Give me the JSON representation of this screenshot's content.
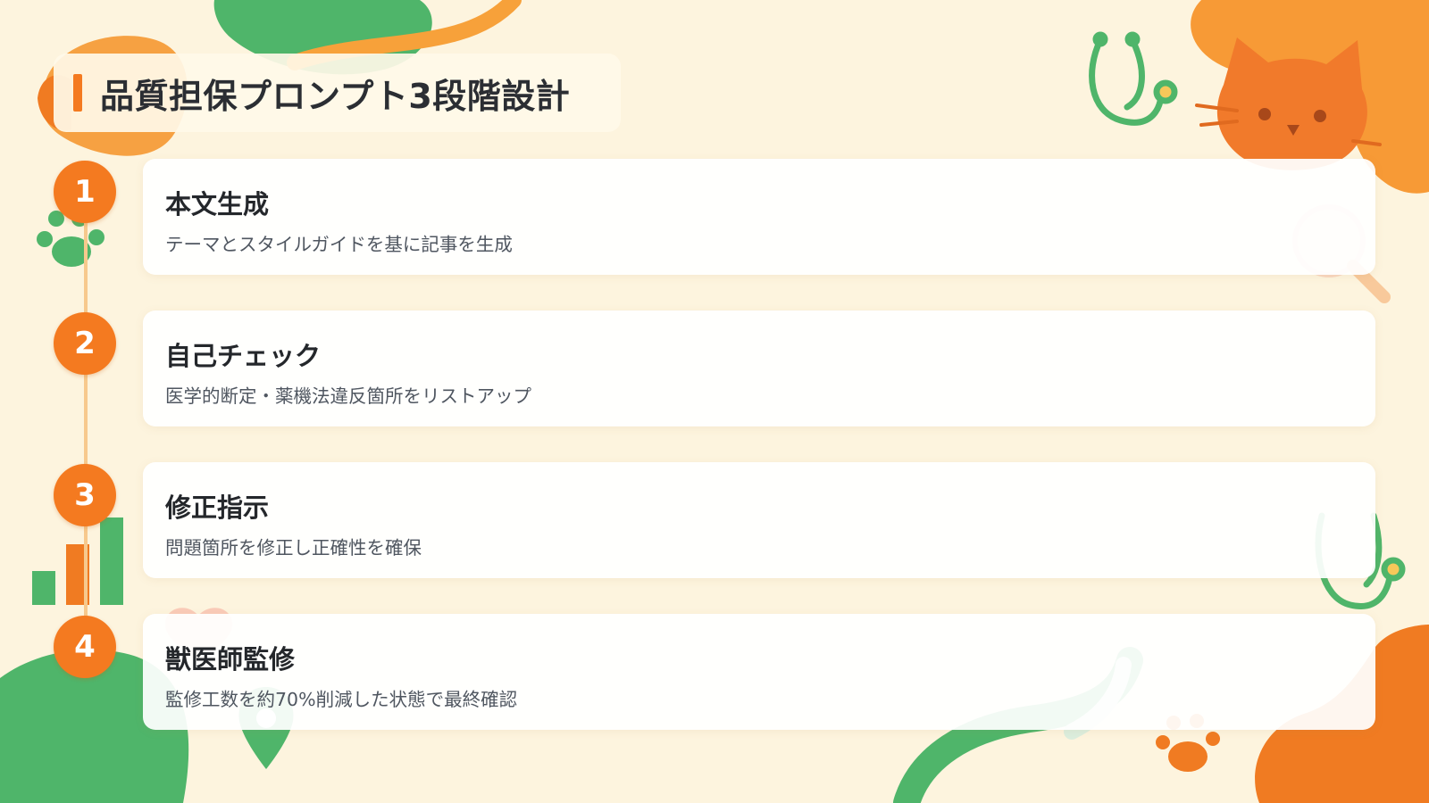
{
  "slide": {
    "title": "品質担保プロンプト3段階設計",
    "accent_color": "#f47a20",
    "background_color": "#fdf4de"
  },
  "steps": [
    {
      "number": "1",
      "title": "本文生成",
      "description": "テーマとスタイルガイドを基に記事を生成"
    },
    {
      "number": "2",
      "title": "自己チェック",
      "description": "医学的断定・薬機法違反箇所をリストアップ"
    },
    {
      "number": "3",
      "title": "修正指示",
      "description": "問題箇所を修正し正確性を確保"
    },
    {
      "number": "4",
      "title": "獣医師監修",
      "description": "監修工数を約70%削減した状態で最終確認"
    }
  ],
  "decorations": [
    "green-blob",
    "orange-blob",
    "stethoscope-icon",
    "cat-icon",
    "magnifier-icon",
    "paw-icon",
    "bar-chart-icon",
    "map-pin-icon",
    "heart-icon"
  ]
}
